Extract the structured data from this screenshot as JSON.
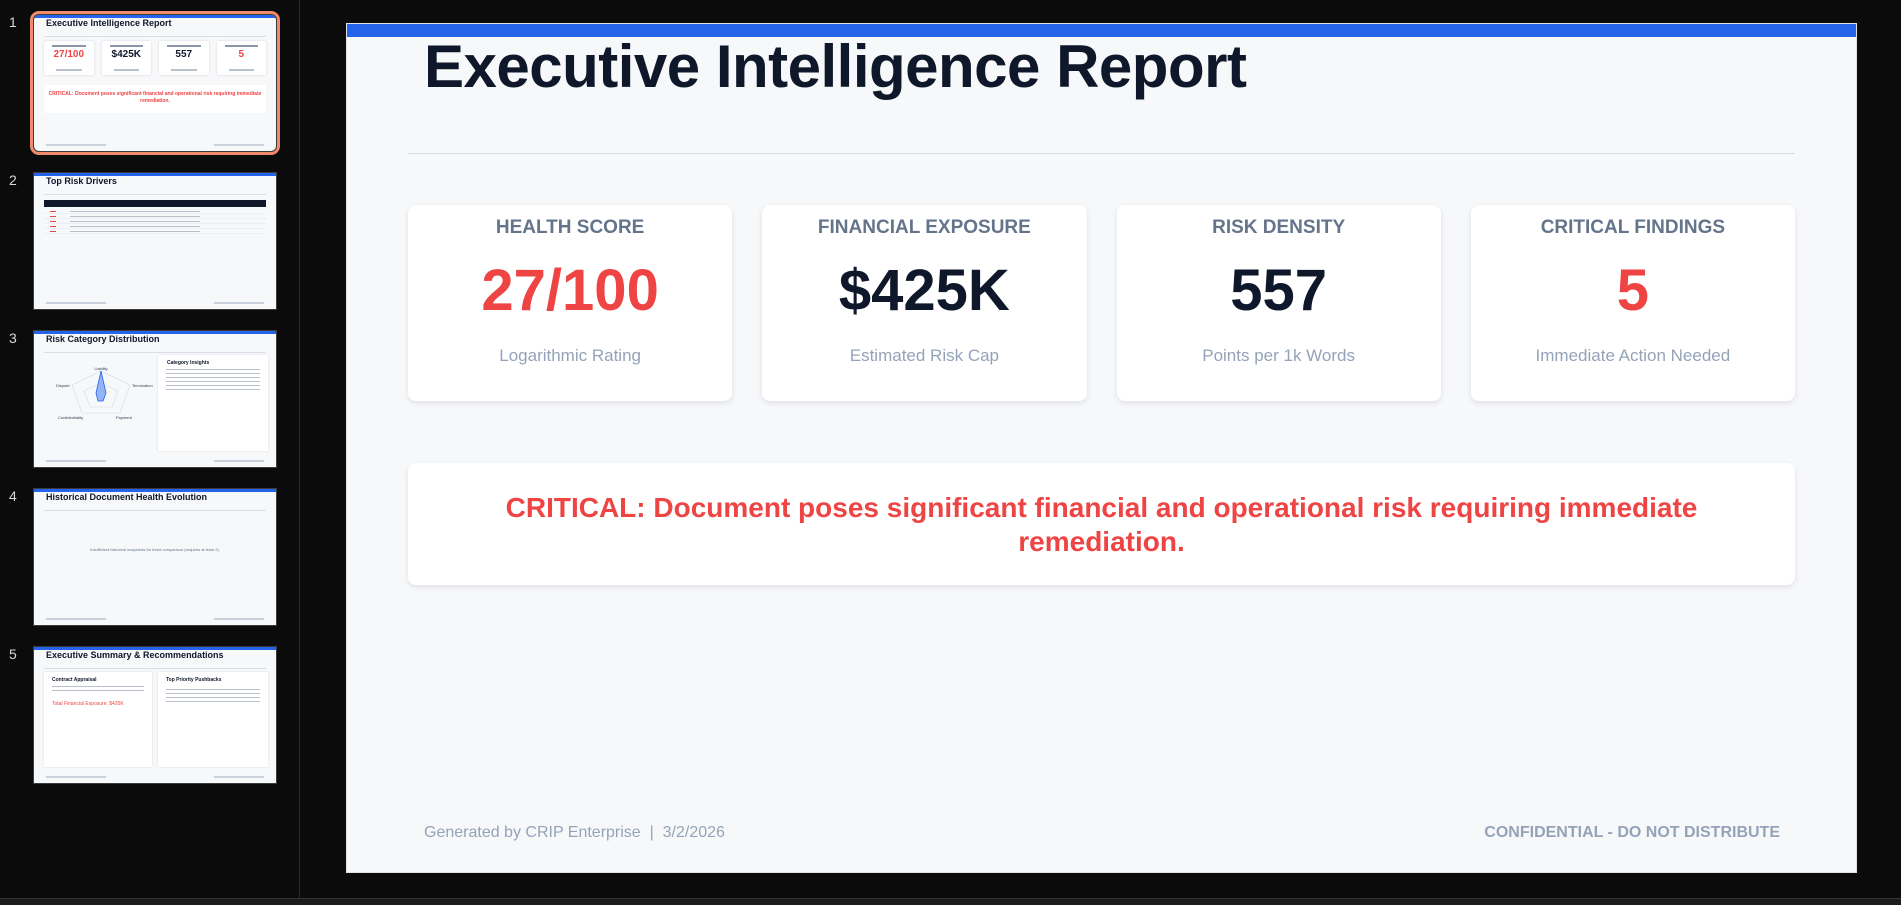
{
  "thumbnails": [
    {
      "number": "1",
      "title": "Executive Intelligence Report",
      "selected": true,
      "kpis": [
        "27/100",
        "$425K",
        "557",
        "5"
      ],
      "alert": "CRITICAL: Document poses significant financial and operational risk requiring immediate remediation."
    },
    {
      "number": "2",
      "title": "Top Risk Drivers"
    },
    {
      "number": "3",
      "title": "Risk Category Distribution",
      "panel_title": "Category Insights",
      "radar_labels": [
        "Liability",
        "Termination",
        "Payment",
        "Confidentiality",
        "Dispute"
      ]
    },
    {
      "number": "4",
      "title": "Historical Document Health Evolution",
      "note": "Insufficient historical snapshots for trend comparison (requires at least 2)."
    },
    {
      "number": "5",
      "title": "Executive Summary & Recommendations",
      "left_heading": "Contract Appraisal",
      "left_exposure": "Total Financial Exposure: $425K",
      "right_heading": "Top Priority Pushbacks"
    }
  ],
  "slide": {
    "title": "Executive Intelligence Report",
    "kpis": [
      {
        "label": "HEALTH SCORE",
        "value": "27/100",
        "sub": "Logarithmic Rating",
        "color": "#ef4444"
      },
      {
        "label": "FINANCIAL EXPOSURE",
        "value": "$425K",
        "sub": "Estimated Risk Cap",
        "color": "#0f172a"
      },
      {
        "label": "RISK DENSITY",
        "value": "557",
        "sub": "Points per 1k Words",
        "color": "#0f172a"
      },
      {
        "label": "CRITICAL FINDINGS",
        "value": "5",
        "sub": "Immediate Action Needed",
        "color": "#ef4444"
      }
    ],
    "alert": "CRITICAL: Document poses significant financial and operational risk requiring immediate remediation.",
    "footer_left": "Generated by CRIP Enterprise  |  3/2/2026",
    "footer_right": "CONFIDENTIAL - DO NOT DISTRIBUTE"
  },
  "colors": {
    "accent": "#2563eb",
    "critical": "#ef4444",
    "selection": "#f08a6b"
  }
}
